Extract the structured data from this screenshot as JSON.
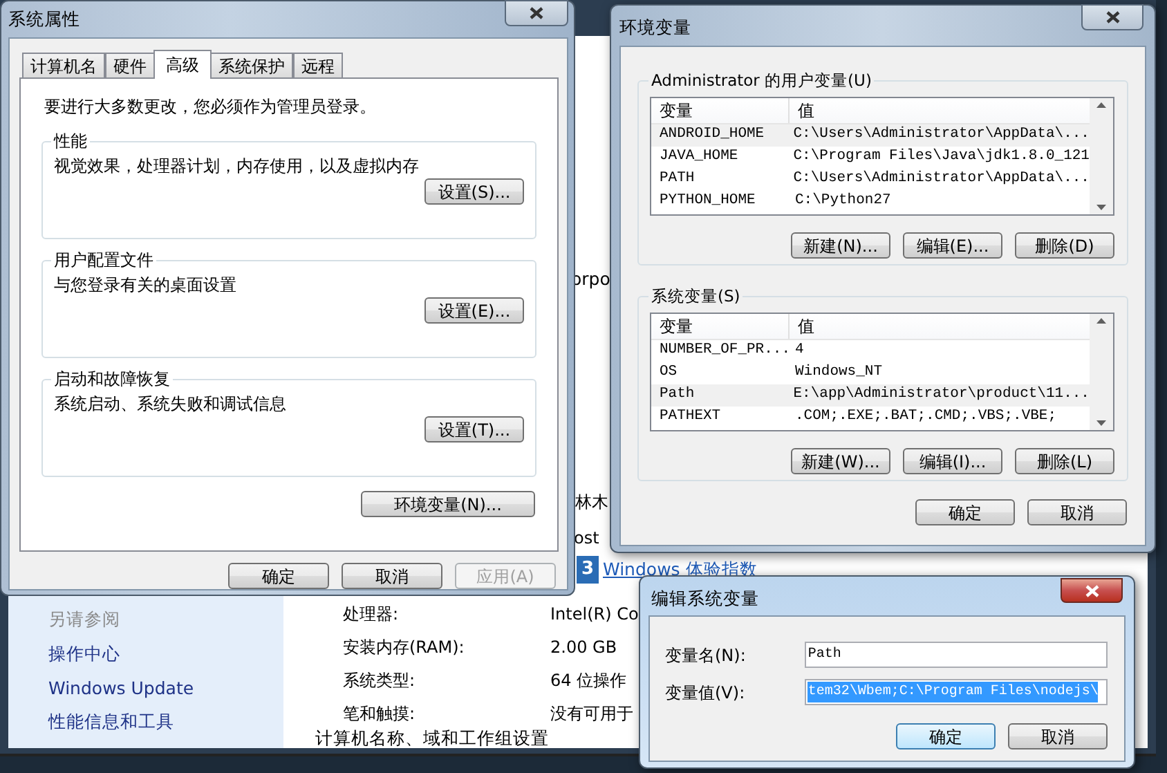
{
  "background_window": {
    "fragments": [
      "orpo",
      "林木",
      "ost"
    ],
    "rating": {
      "score": "3",
      "link": "Windows 体验指数"
    },
    "sidebar": {
      "heading": "另请参阅",
      "links": [
        "操作中心",
        "Windows Update",
        "性能信息和工具"
      ]
    },
    "specs": [
      {
        "label": "处理器:",
        "value": "Intel(R) Co"
      },
      {
        "label": "安装内存(RAM):",
        "value": "2.00 GB"
      },
      {
        "label": "系统类型:",
        "value": "64 位操作"
      },
      {
        "label": "笔和触摸:",
        "value": "没有可用于"
      }
    ],
    "section_heading": "计算机名称、域和工作组设置"
  },
  "system_properties": {
    "title": "系统属性",
    "tabs": [
      {
        "label": "计算机名",
        "selected": false
      },
      {
        "label": "硬件",
        "selected": false
      },
      {
        "label": "高级",
        "selected": true
      },
      {
        "label": "系统保护",
        "selected": false
      },
      {
        "label": "远程",
        "selected": false
      }
    ],
    "notice": "要进行大多数更改，您必须作为管理员登录。",
    "groups": [
      {
        "title": "性能",
        "description": "视觉效果，处理器计划，内存使用，以及虚拟内存",
        "button": "设置(S)..."
      },
      {
        "title": "用户配置文件",
        "description": "与您登录有关的桌面设置",
        "button": "设置(E)..."
      },
      {
        "title": "启动和故障恢复",
        "description": "系统启动、系统失败和调试信息",
        "button": "设置(T)..."
      }
    ],
    "env_button": "环境变量(N)...",
    "buttons": [
      {
        "label": "确定",
        "disabled": false
      },
      {
        "label": "取消",
        "disabled": false
      },
      {
        "label": "应用(A)",
        "disabled": true
      }
    ]
  },
  "environment_variables": {
    "title": "环境变量",
    "sections": [
      {
        "title": "Administrator 的用户变量(U)",
        "columns": [
          "变量",
          "值"
        ],
        "rows": [
          {
            "name": "ANDROID_HOME",
            "value": "C:\\Users\\Administrator\\AppData\\...",
            "selected": true
          },
          {
            "name": "JAVA_HOME",
            "value": "C:\\Program Files\\Java\\jdk1.8.0_121",
            "selected": false
          },
          {
            "name": "PATH",
            "value": "C:\\Users\\Administrator\\AppData\\...",
            "selected": false
          },
          {
            "name": "PYTHON_HOME",
            "value": "C:\\Python27",
            "selected": false
          }
        ],
        "buttons": [
          "新建(N)...",
          "编辑(E)...",
          "删除(D)"
        ]
      },
      {
        "title": "系统变量(S)",
        "columns": [
          "变量",
          "值"
        ],
        "rows": [
          {
            "name": "NUMBER_OF_PR...",
            "value": "4",
            "selected": false
          },
          {
            "name": "OS",
            "value": "Windows_NT",
            "selected": false
          },
          {
            "name": "Path",
            "value": "E:\\app\\Administrator\\product\\11...",
            "selected": true
          },
          {
            "name": "PATHEXT",
            "value": ".COM;.EXE;.BAT;.CMD;.VBS;.VBE;",
            "selected": false
          }
        ],
        "buttons": [
          "新建(W)...",
          "编辑(I)...",
          "删除(L)"
        ]
      }
    ],
    "buttons": [
      "确定",
      "取消"
    ]
  },
  "edit_dialog": {
    "title": "编辑系统变量",
    "fields": [
      {
        "label": "变量名(N):",
        "value": "Path",
        "selected": false
      },
      {
        "label": "变量值(V):",
        "value": "tem32\\Wbem;C:\\Program Files\\nodejs\\",
        "selected": true
      }
    ],
    "buttons": [
      {
        "label": "确定",
        "default": true
      },
      {
        "label": "取消",
        "default": false
      }
    ]
  }
}
